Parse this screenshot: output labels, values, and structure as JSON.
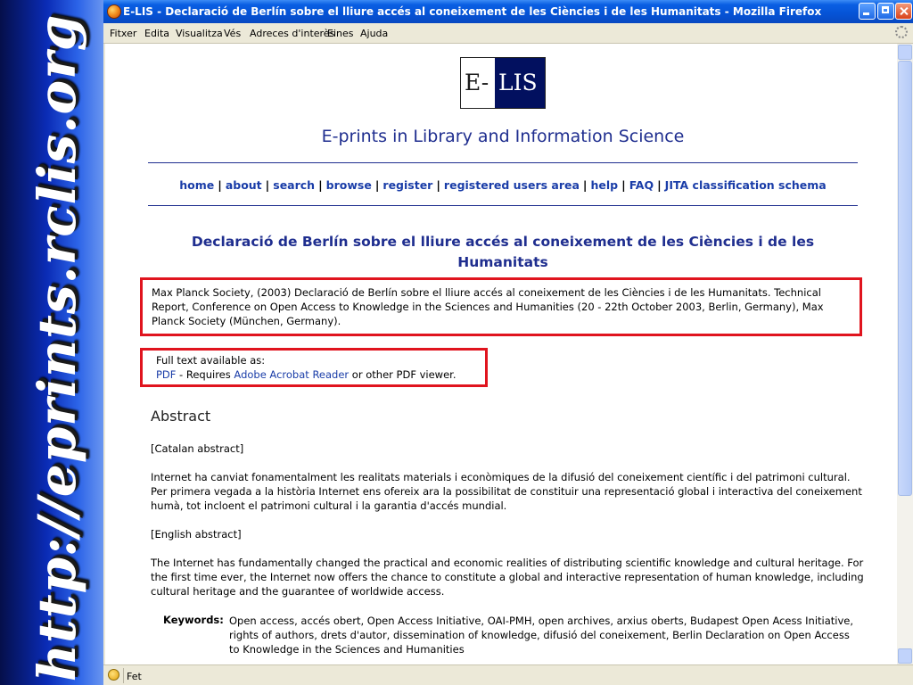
{
  "banner": {
    "text": "http://eprints.rclis.org"
  },
  "window": {
    "title": "E-LIS - Declaració de Berlín sobre el lliure accés al coneixement de les Ciències i de les Humanitats - Mozilla Firefox"
  },
  "menu": [
    "Fitxer",
    "Edita",
    "Visualitza",
    "Vés",
    "Adreces d'interès",
    "Eines",
    "Ajuda"
  ],
  "logo": {
    "left": "E-",
    "right": "LIS"
  },
  "site": {
    "title": "E-prints in Library and Information Science"
  },
  "nav": [
    "home",
    "about",
    "search",
    "browse",
    "register",
    "registered users area",
    "help",
    "FAQ",
    "JITA classification schema"
  ],
  "document": {
    "title": "Declaració de Berlín sobre el lliure accés al coneixement de les Ciències i de les Humanitats",
    "citation": "Max Planck Society, (2003) Declaració de Berlín sobre el lliure accés al coneixement de les Ciències i de les Humanitats. Technical Report, Conference on Open Access to Knowledge in the Sciences and Humanities (20 - 22th October 2003, Berlin, Germany), Max Planck Society (München, Germany).",
    "fulltext": {
      "label": "Full text available as:",
      "pdf": "PDF",
      "requires": " - Requires ",
      "reader": "Adobe Acrobat Reader",
      "other": " or other PDF viewer."
    },
    "abstract": {
      "heading": "Abstract",
      "catalan_label": "[Catalan abstract]",
      "catalan_text": "Internet ha canviat fonamentalment les realitats materials i econòmiques de la difusió del coneixement científic i del patrimoni cultural. Per primera vegada a la història Internet ens ofereix ara la possibilitat de constituir una representació global i interactiva del coneixement humà, tot incloent el patrimoni cultural i la garantia d'accés mundial.",
      "english_label": "[English abstract]",
      "english_text": "The Internet has fundamentally changed the practical and economic realities of distributing scientific knowledge and cultural heritage. For the first time ever, the Internet now offers the chance to constitute a global and interactive representation of human knowledge, including cultural heritage and the guarantee of worldwide access."
    },
    "keywords": {
      "label": "Keywords:",
      "text": "Open access, accés obert, Open Access Initiative, OAI-PMH, open archives, arxius oberts, Budapest Open Acess Initiative, rights of authors, drets d'autor, dissemination of knowledge, difusió del coneixement, Berlin Declaration on Open Access to Knowledge in the Sciences and Humanities"
    }
  },
  "status": {
    "text": "Fet"
  },
  "colors": {
    "title_blue": "#1f2e8f",
    "link_blue": "#1a3da8",
    "highlight_red": "#e0141e",
    "logo_navy": "#02105f"
  }
}
